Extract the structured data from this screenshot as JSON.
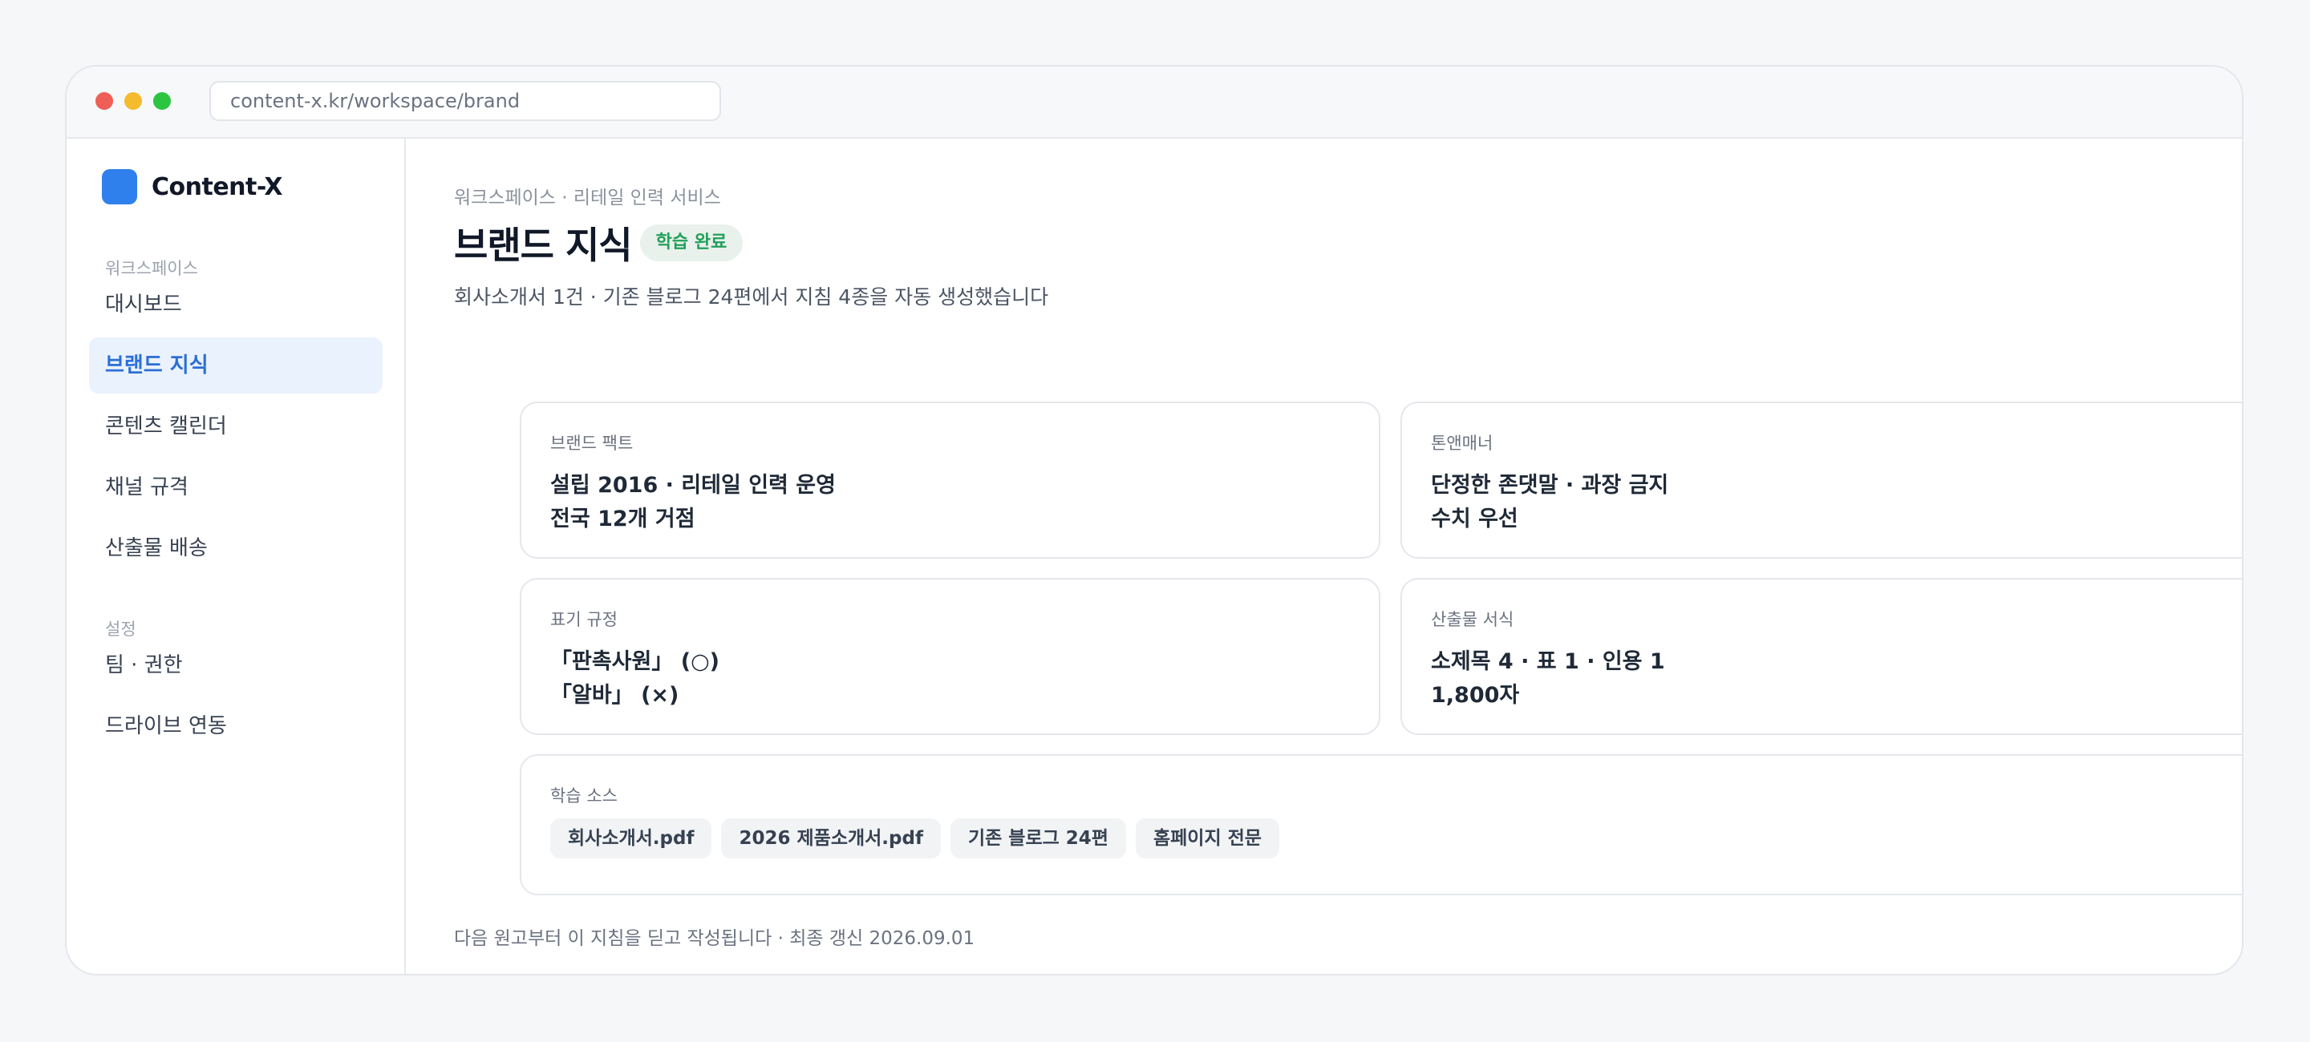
{
  "window": {
    "url": "content-x.kr/workspace/brand"
  },
  "sidebar": {
    "brand_name": "Content-X",
    "sections": [
      {
        "label": "워크스페이스",
        "items": [
          {
            "label": "대시보드",
            "active": false
          },
          {
            "label": "브랜드 지식",
            "active": true
          },
          {
            "label": "콘텐츠 캘린더",
            "active": false
          },
          {
            "label": "채널 규격",
            "active": false
          },
          {
            "label": "산출물 배송",
            "active": false
          }
        ]
      },
      {
        "label": "설정",
        "items": [
          {
            "label": "팀 · 권한",
            "active": false
          },
          {
            "label": "드라이브 연동",
            "active": false
          }
        ]
      }
    ]
  },
  "main": {
    "breadcrumb": "워크스페이스 · 리테일 인력 서비스",
    "title": "브랜드 지식",
    "badge": "학습 완료",
    "subtitle": "회사소개서 1건 · 기존 블로그 24편에서 지침 4종을 자동 생성했습니다",
    "cards": [
      {
        "label": "브랜드 팩트",
        "lines": [
          "설립 2016 · 리테일 인력 운영",
          "전국 12개 거점"
        ]
      },
      {
        "label": "톤앤매너",
        "lines": [
          "단정한 존댓말 · 과장 금지",
          "수치 우선"
        ]
      },
      {
        "label": "표기 규정",
        "lines": [
          "「판촉사원」 (○)",
          "「알바」 (×)"
        ]
      },
      {
        "label": "산출물 서식",
        "lines": [
          "소제목 4 · 표 1 · 인용 1",
          "1,800자"
        ]
      }
    ],
    "sources": {
      "label": "학습 소스",
      "chips": [
        "회사소개서.pdf",
        "2026 제품소개서.pdf",
        "기존 블로그 24편",
        "홈페이지 전문"
      ]
    },
    "footer_note": "다음 원고부터 이 지침을 딛고 작성됩니다 · 최종 갱신 2026.09.01"
  },
  "colors": {
    "accent": "#2f80ed",
    "active_nav_bg": "#eaf2fe",
    "badge_text": "#21a05a",
    "badge_bg": "#e9f1ec"
  }
}
